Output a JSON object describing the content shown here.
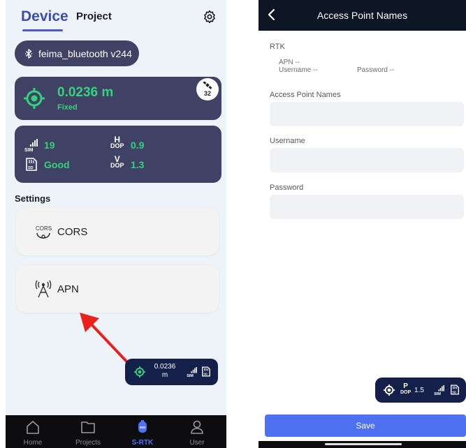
{
  "left_screen": {
    "tabs": {
      "device": "Device",
      "project": "Project"
    },
    "bluetooth": {
      "label": "feima_bluetooth v244"
    },
    "fix": {
      "value": "0.0236 m",
      "status": "Fixed",
      "satellites": "32"
    },
    "stats": {
      "sim_signal": "19",
      "sd_status": "Good",
      "hdop": {
        "top": "H",
        "bottom": "DOP",
        "value": "0.9"
      },
      "vdop": {
        "top": "V",
        "bottom": "DOP",
        "value": "1.3"
      }
    },
    "settings_title": "Settings",
    "settings_items": [
      {
        "label": "CORS",
        "icon": "cors-icon"
      },
      {
        "label": "APN",
        "icon": "antenna-icon"
      }
    ],
    "mini_status": {
      "value_line1": "0.0236",
      "value_line2": "m"
    },
    "bottom_nav": [
      {
        "label": "Home",
        "icon": "home-icon"
      },
      {
        "label": "Projects",
        "icon": "folder-icon"
      },
      {
        "label": "S-RTK",
        "icon": "receiver-icon",
        "active": true
      },
      {
        "label": "User",
        "icon": "user-icon"
      }
    ]
  },
  "right_screen": {
    "header": {
      "title": "Access Point Names"
    },
    "rtk": {
      "section": "RTK",
      "apn_line": "APN  --",
      "username_line": "Username  --",
      "password_line": "Password  --"
    },
    "fields": {
      "apn_label": "Access Point Names",
      "username_label": "Username",
      "password_label": "Password",
      "apn_value": "",
      "username_value": "",
      "password_value": ""
    },
    "mini_status": {
      "pdop_top": "P",
      "pdop_bottom": "DOP",
      "pdop_value": "1.5"
    },
    "save_label": "Save"
  },
  "colors": {
    "accent_blue": "#4d71f0",
    "card_bg": "#3f4264",
    "fix_green": "#34d27a",
    "annotation_arrow": "#e8211d"
  }
}
